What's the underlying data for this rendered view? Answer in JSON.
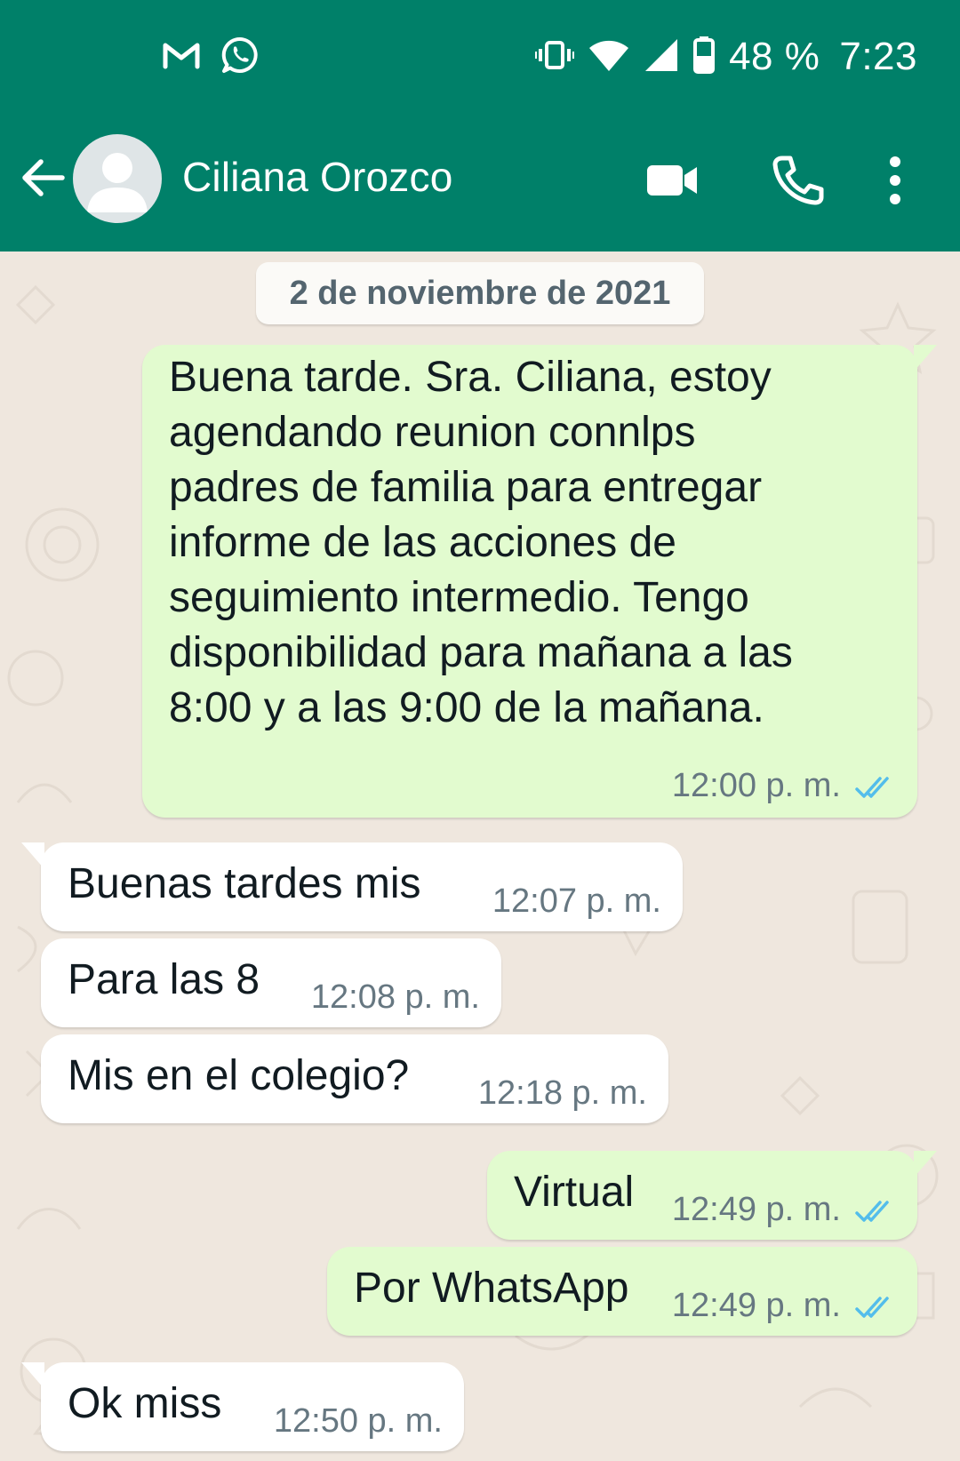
{
  "status_bar": {
    "battery": "48 %",
    "clock": "7:23",
    "notification_icons": [
      "gmail-icon",
      "whatsapp-icon"
    ],
    "system_icons": [
      "vibrate-icon",
      "wifi-icon",
      "signal-icon",
      "battery-icon"
    ]
  },
  "header": {
    "contact_name": "Ciliana Orozco",
    "actions": [
      "video-call-icon",
      "voice-call-icon",
      "more-options-icon"
    ]
  },
  "chat": {
    "date_chip": "2 de noviembre de 2021",
    "messages": [
      {
        "direction": "outgoing",
        "text": "Buena tarde. Sra. Ciliana, estoy\nagendando reunion connlps\npadres de familia para entregar\ninforme de las acciones de\nseguimiento intermedio. Tengo\ndisponibilidad para mañana a las\n8:00 y a las 9:00 de la mañana.",
        "time": "12:00 p. m.",
        "status": "read"
      },
      {
        "direction": "incoming",
        "text": "Buenas tardes mis",
        "time": "12:07 p. m."
      },
      {
        "direction": "incoming",
        "text": "Para las 8",
        "time": "12:08 p. m."
      },
      {
        "direction": "incoming",
        "text": "Mis en el colegio?",
        "time": "12:18 p. m."
      },
      {
        "direction": "outgoing",
        "text": "Virtual",
        "time": "12:49 p. m.",
        "status": "read"
      },
      {
        "direction": "outgoing",
        "text": "Por WhatsApp",
        "time": "12:49 p. m.",
        "status": "read"
      },
      {
        "direction": "incoming",
        "text": "Ok miss",
        "time": "12:50 p. m."
      }
    ]
  },
  "colors": {
    "brand_green": "#008069",
    "outgoing_bubble": "#e2fbcf",
    "incoming_bubble": "#ffffff",
    "chat_background": "#efe7de",
    "read_ticks": "#53bdeb"
  }
}
